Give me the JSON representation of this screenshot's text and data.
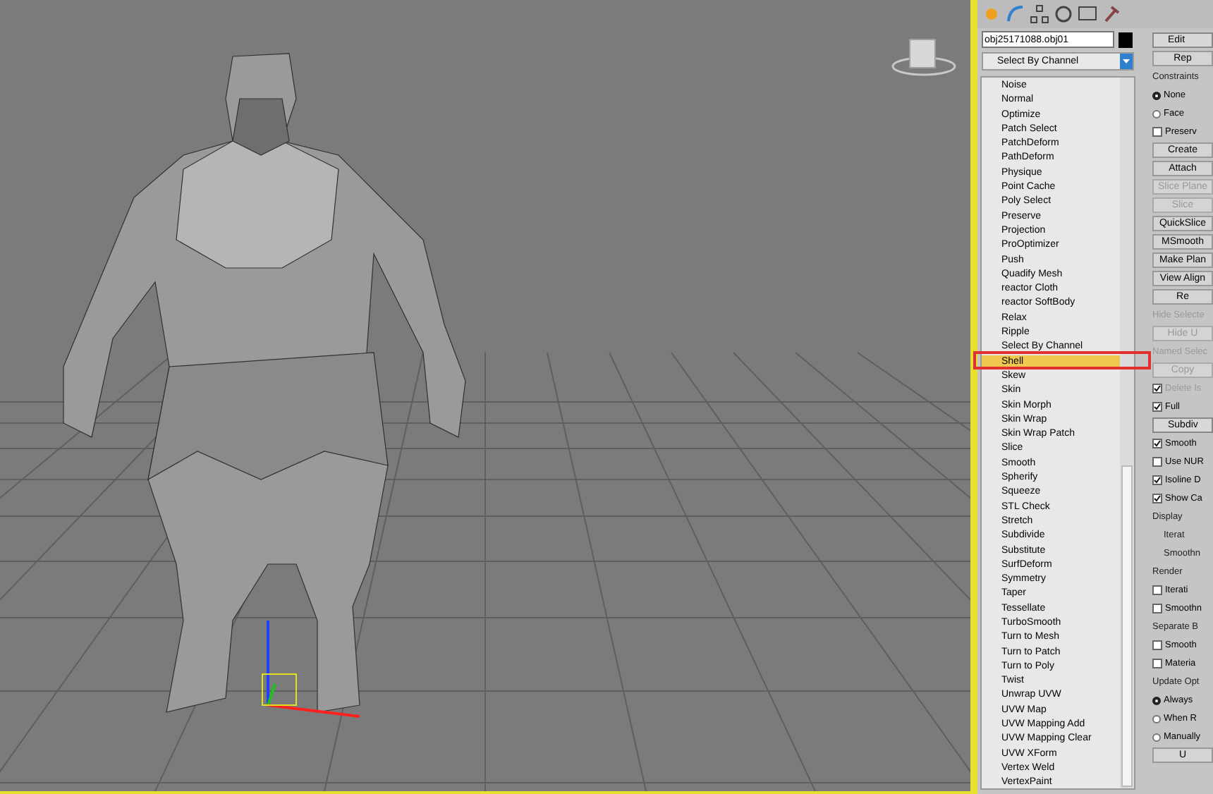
{
  "object_name": "obj25171088.obj01",
  "modifier_dropdown": "Select By Channel",
  "modifiers": [
    {
      "label": "Noise",
      "selected": false
    },
    {
      "label": "Normal",
      "selected": false
    },
    {
      "label": "Optimize",
      "selected": false
    },
    {
      "label": "Patch Select",
      "selected": false
    },
    {
      "label": "PatchDeform",
      "selected": false
    },
    {
      "label": "PathDeform",
      "selected": false
    },
    {
      "label": "Physique",
      "selected": false
    },
    {
      "label": "Point Cache",
      "selected": false
    },
    {
      "label": "Poly Select",
      "selected": false
    },
    {
      "label": "Preserve",
      "selected": false
    },
    {
      "label": "Projection",
      "selected": false
    },
    {
      "label": "ProOptimizer",
      "selected": false
    },
    {
      "label": "Push",
      "selected": false
    },
    {
      "label": "Quadify Mesh",
      "selected": false
    },
    {
      "label": "reactor Cloth",
      "selected": false
    },
    {
      "label": "reactor SoftBody",
      "selected": false
    },
    {
      "label": "Relax",
      "selected": false
    },
    {
      "label": "Ripple",
      "selected": false
    },
    {
      "label": "Select By Channel",
      "selected": false
    },
    {
      "label": "Shell",
      "selected": true
    },
    {
      "label": "Skew",
      "selected": false
    },
    {
      "label": "Skin",
      "selected": false
    },
    {
      "label": "Skin Morph",
      "selected": false
    },
    {
      "label": "Skin Wrap",
      "selected": false
    },
    {
      "label": "Skin Wrap Patch",
      "selected": false
    },
    {
      "label": "Slice",
      "selected": false
    },
    {
      "label": "Smooth",
      "selected": false
    },
    {
      "label": "Spherify",
      "selected": false
    },
    {
      "label": "Squeeze",
      "selected": false
    },
    {
      "label": "STL Check",
      "selected": false
    },
    {
      "label": "Stretch",
      "selected": false
    },
    {
      "label": "Subdivide",
      "selected": false
    },
    {
      "label": "Substitute",
      "selected": false
    },
    {
      "label": "SurfDeform",
      "selected": false
    },
    {
      "label": "Symmetry",
      "selected": false
    },
    {
      "label": "Taper",
      "selected": false
    },
    {
      "label": "Tessellate",
      "selected": false
    },
    {
      "label": "TurboSmooth",
      "selected": false
    },
    {
      "label": "Turn to Mesh",
      "selected": false
    },
    {
      "label": "Turn to Patch",
      "selected": false
    },
    {
      "label": "Turn to Poly",
      "selected": false
    },
    {
      "label": "Twist",
      "selected": false
    },
    {
      "label": "Unwrap UVW",
      "selected": false
    },
    {
      "label": "UVW Map",
      "selected": false
    },
    {
      "label": "UVW Mapping Add",
      "selected": false
    },
    {
      "label": "UVW Mapping Clear",
      "selected": false
    },
    {
      "label": "UVW XForm",
      "selected": false
    },
    {
      "label": "Vertex Weld",
      "selected": false
    },
    {
      "label": "VertexPaint",
      "selected": false
    }
  ],
  "properties": [
    {
      "kind": "header",
      "label": "Edit"
    },
    {
      "kind": "button",
      "label": "Rep"
    },
    {
      "kind": "group",
      "label": "Constraints"
    },
    {
      "kind": "radio",
      "label": "None",
      "checked": true
    },
    {
      "kind": "radio",
      "label": "Face",
      "checked": false
    },
    {
      "kind": "checkbox",
      "label": "Preserv",
      "checked": false
    },
    {
      "kind": "button",
      "label": "Create"
    },
    {
      "kind": "button",
      "label": "Attach"
    },
    {
      "kind": "disabled_button",
      "label": "Slice Plane"
    },
    {
      "kind": "disabled_button",
      "label": "Slice"
    },
    {
      "kind": "button",
      "label": "QuickSlice"
    },
    {
      "kind": "button",
      "label": "MSmooth"
    },
    {
      "kind": "button",
      "label": "Make Plan"
    },
    {
      "kind": "button",
      "label": "View Align"
    },
    {
      "kind": "button",
      "label": "Re"
    },
    {
      "kind": "disabled_label",
      "label": "Hide Selecte"
    },
    {
      "kind": "disabled_button",
      "label": "Hide U"
    },
    {
      "kind": "disabled_label",
      "label": "Named Selec"
    },
    {
      "kind": "disabled_button",
      "label": "Copy"
    },
    {
      "kind": "disabled_checkbox",
      "label": "Delete Is",
      "checked": true
    },
    {
      "kind": "checkbox",
      "label": "Full",
      "checked": true
    },
    {
      "kind": "header",
      "label": "Subdiv"
    },
    {
      "kind": "checkbox",
      "label": "Smooth",
      "checked": true
    },
    {
      "kind": "checkbox",
      "label": "Use NUR",
      "checked": false
    },
    {
      "kind": "checkbox",
      "label": "Isoline D",
      "checked": true
    },
    {
      "kind": "checkbox",
      "label": "Show Ca",
      "checked": true
    },
    {
      "kind": "group",
      "label": "Display"
    },
    {
      "kind": "label",
      "label": "Iterat"
    },
    {
      "kind": "label",
      "label": "Smoothn"
    },
    {
      "kind": "group",
      "label": "Render"
    },
    {
      "kind": "checkbox",
      "label": "Iterati",
      "checked": false
    },
    {
      "kind": "checkbox",
      "label": "Smoothn",
      "checked": false
    },
    {
      "kind": "group",
      "label": "Separate B"
    },
    {
      "kind": "checkbox",
      "label": "Smooth",
      "checked": false
    },
    {
      "kind": "checkbox",
      "label": "Materia",
      "checked": false
    },
    {
      "kind": "group",
      "label": "Update Opt"
    },
    {
      "kind": "radio",
      "label": "Always",
      "checked": true
    },
    {
      "kind": "radio",
      "label": "When R",
      "checked": false
    },
    {
      "kind": "radio",
      "label": "Manually",
      "checked": false
    },
    {
      "kind": "button",
      "label": "U"
    }
  ]
}
